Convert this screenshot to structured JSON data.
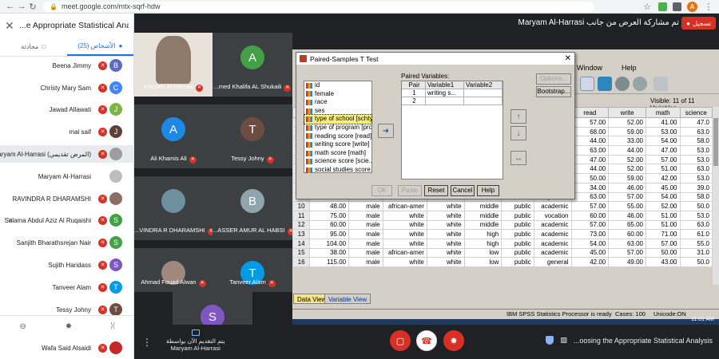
{
  "browser": {
    "url": "meet.google.com/mtx-sqrf-hdw"
  },
  "left_panel": {
    "title": "...e Appropriate Statistical Analysis",
    "tab_people_label": "الأشخاص (25)",
    "tab_chat_label": "محادثة",
    "people": [
      {
        "name": "Beena Jimmy",
        "initial": "B",
        "color": "#5c6bc0",
        "muted": true
      },
      {
        "name": "Christy Mary Sam",
        "initial": "C",
        "color": "#4285f4",
        "muted": true
      },
      {
        "name": "Jawad Allawati",
        "initial": "J",
        "color": "#7cb342",
        "muted": true
      },
      {
        "name": "mai saif",
        "initial": "J",
        "color": "#5d4037",
        "muted": true
      },
      {
        "name": "Maryam Al-Harrasi (المرض تقديمي)",
        "initial": "",
        "color": "#9e9e9e",
        "muted": true,
        "highlight": true
      },
      {
        "name": "Maryam Al-Harrasi",
        "initial": "",
        "color": "#bdbdbd",
        "muted": false
      },
      {
        "name": "RAVINDRA R DHARAMSHI",
        "initial": "",
        "color": "#8d6e63",
        "muted": true
      },
      {
        "name": "Salama Abdul Aziz Al Ruqaishi",
        "initial": "S",
        "color": "#43a047",
        "muted": true,
        "expand": true
      },
      {
        "name": "Sanjith Bharathsrejan Nair",
        "initial": "S",
        "color": "#43a047",
        "muted": true
      },
      {
        "name": "Sujith Haridass",
        "initial": "S",
        "color": "#7e57c2",
        "muted": true
      },
      {
        "name": "Tanveer Alam",
        "initial": "T",
        "color": "#039be5",
        "muted": true
      },
      {
        "name": "Tessy Johny",
        "initial": "T",
        "color": "#6d4c41",
        "muted": true
      },
      {
        "name": "Wafa Said Alsaidi",
        "initial": "",
        "color": "#c62828",
        "muted": true
      }
    ]
  },
  "meet_top": {
    "presenting_label": "Maryam Al-Harrasi تم مشاركة العرض من جانب",
    "record_label": "تسجيل"
  },
  "tiles": [
    {
      "name": "Maryam Al-Harrasi",
      "initial": "",
      "color": "#8d7a6b",
      "video": true
    },
    {
      "name": "...med Khalifa AL Shukaili",
      "initial": "A",
      "color": "#43a047"
    },
    {
      "name": "Ali Khamis Ali",
      "initial": "A",
      "color": "#1e88e5"
    },
    {
      "name": "Tessy Johny",
      "initial": "T",
      "color": "#6d4c41"
    },
    {
      "name": "...VINDRA R DHARAMSHI",
      "initial": "",
      "color": "#6d8f9e",
      "video": true
    },
    {
      "name": "...ASSER AMUR AL HABSI",
      "initial": "B",
      "color": "#90a4ae"
    },
    {
      "name": "Ahmad Fouad Alwan",
      "initial": "",
      "color": "#a1887f",
      "video": true
    },
    {
      "name": "Tanveer Alam",
      "initial": "T",
      "color": "#039be5"
    },
    {
      "name": "",
      "initial": "S",
      "color": "#7e57c2"
    }
  ],
  "spss": {
    "menu": [
      "Window",
      "Help"
    ],
    "visible_text": "Visible: 11 of 11 Variables",
    "columns": [
      "",
      "read",
      "write",
      "math",
      "science"
    ],
    "rows": [
      {
        "n": "",
        "c": [
          "",
          "",
          "",
          "",
          "",
          "",
          "",
          "57.00",
          "52.00",
          "41.00",
          "47.0"
        ]
      },
      {
        "n": "",
        "c": [
          "",
          "",
          "",
          "",
          "",
          "",
          "",
          "68.00",
          "59.00",
          "53.00",
          "63.0"
        ]
      },
      {
        "n": "",
        "c": [
          "",
          "",
          "",
          "",
          "",
          "",
          "",
          "44.00",
          "33.00",
          "54.00",
          "58.0"
        ]
      },
      {
        "n": "",
        "c": [
          "",
          "",
          "",
          "",
          "",
          "",
          "",
          "63.00",
          "44.00",
          "47.00",
          "53.0"
        ]
      },
      {
        "n": "",
        "c": [
          "",
          "",
          "",
          "",
          "",
          "",
          "",
          "47.00",
          "52.00",
          "57.00",
          "53.0"
        ]
      },
      {
        "n": "",
        "c": [
          "",
          "",
          "",
          "",
          "",
          "",
          "",
          "44.00",
          "52.00",
          "51.00",
          "63.0"
        ]
      },
      {
        "n": "",
        "c": [
          "",
          "",
          "",
          "",
          "",
          "",
          "",
          "50.00",
          "59.00",
          "42.00",
          "53.0"
        ]
      },
      {
        "n": "",
        "c": [
          "",
          "",
          "",
          "",
          "",
          "",
          "",
          "34.00",
          "46.00",
          "45.00",
          "39.0"
        ]
      },
      {
        "n": "9",
        "c": [
          "84.00",
          "male",
          "african-amer",
          "white",
          "middle",
          "public",
          "general",
          "63.00",
          "57.00",
          "54.00",
          "58.0"
        ]
      },
      {
        "n": "10",
        "c": [
          "48.00",
          "male",
          "african-amer",
          "white",
          "middle",
          "public",
          "academic",
          "57.00",
          "55.00",
          "52.00",
          "50.0"
        ]
      },
      {
        "n": "11",
        "c": [
          "75.00",
          "male",
          "white",
          "white",
          "middle",
          "public",
          "vocation",
          "60.00",
          "46.00",
          "51.00",
          "53.0"
        ]
      },
      {
        "n": "12",
        "c": [
          "60.00",
          "male",
          "white",
          "white",
          "middle",
          "public",
          "academic",
          "57.00",
          "65.00",
          "51.00",
          "63.0"
        ]
      },
      {
        "n": "13",
        "c": [
          "95.00",
          "male",
          "white",
          "white",
          "high",
          "public",
          "academic",
          "73.00",
          "60.00",
          "71.00",
          "61.0"
        ]
      },
      {
        "n": "14",
        "c": [
          "104.00",
          "male",
          "white",
          "white",
          "high",
          "public",
          "academic",
          "54.00",
          "63.00",
          "57.00",
          "55.0"
        ]
      },
      {
        "n": "15",
        "c": [
          "38.00",
          "male",
          "african-amer",
          "white",
          "low",
          "public",
          "academic",
          "45.00",
          "57.00",
          "50.00",
          "31.0"
        ]
      },
      {
        "n": "16",
        "c": [
          "115.00",
          "male",
          "white",
          "white",
          "low",
          "public",
          "general",
          "42.00",
          "49.00",
          "43.00",
          "50.0"
        ]
      }
    ],
    "tab_data_view": "Data View",
    "tab_variable_view": "Variable View",
    "status_processor": "IBM SPSS Statistics Processor is ready",
    "status_cases": "Cases: 100",
    "status_unicode": "Unicode:ON",
    "clock": "11:01 AM"
  },
  "dialog": {
    "title": "Paired-Samples T Test",
    "variables": [
      "id",
      "female",
      "race",
      "ses",
      "type of school [schtyp]",
      "type of program [prog]",
      "reading score [read]",
      "writing score [write]",
      "math score [math]",
      "science score [scie...",
      "social studies score..."
    ],
    "selected_index": 4,
    "paired_label": "Paired Variables:",
    "pair_headers": [
      "Pair",
      "Variable1",
      "Variable2"
    ],
    "pair_rows": [
      {
        "pair": "1",
        "v1": "writing s...",
        "v2": ""
      },
      {
        "pair": "2",
        "v1": "",
        "v2": ""
      }
    ],
    "btn_options": "Options...",
    "btn_bootstrap": "Bootstrap...",
    "btn_ok": "OK",
    "btn_paste": "Paste",
    "btn_reset": "Reset",
    "btn_cancel": "Cancel",
    "btn_help": "Help"
  },
  "meet_bottom": {
    "presenter_label": "يتم التقديم الآن بواسطة",
    "presenter_name": "Maryam Al-Harrasi",
    "meeting_title": "...oosing the Appropriate Statistical Analysis"
  }
}
